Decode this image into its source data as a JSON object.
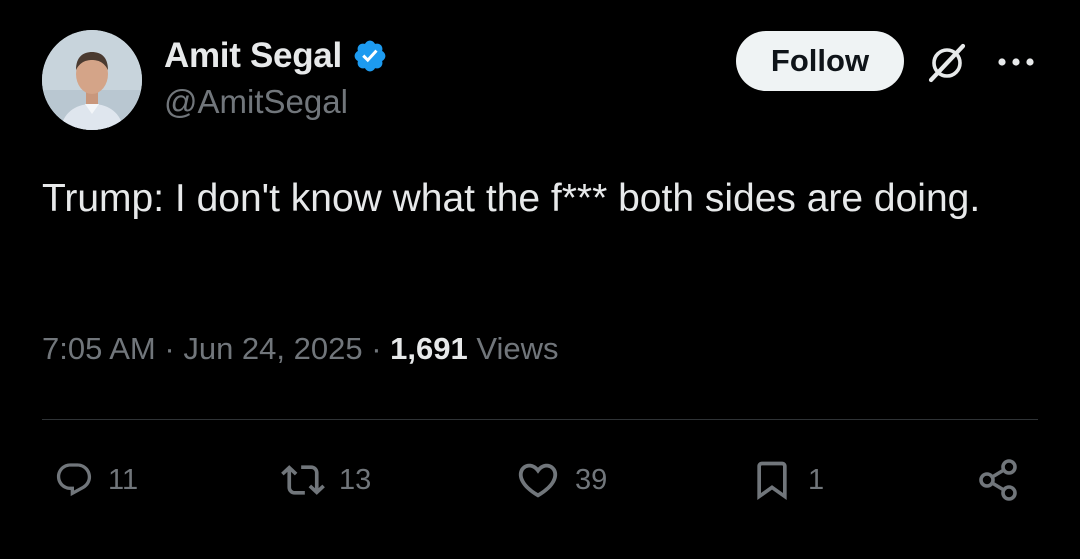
{
  "author": {
    "display_name": "Amit Segal",
    "handle": "@AmitSegal",
    "verified": true
  },
  "header": {
    "follow_label": "Follow"
  },
  "tweet": {
    "text": "Trump: I don't know what the f*** both sides are doing.",
    "time": "7:05 AM",
    "separator": "·",
    "date": "Jun 24, 2025",
    "views_count": "1,691",
    "views_label": "Views"
  },
  "actions": {
    "replies": "11",
    "reposts": "13",
    "likes": "39",
    "bookmarks": "1"
  },
  "icons": {
    "verified": "verified-badge-icon",
    "grok": "grok-icon",
    "more": "more-horizontal-icon",
    "reply": "reply-icon",
    "repost": "repost-icon",
    "like": "heart-icon",
    "bookmark": "bookmark-icon",
    "share": "share-icon"
  },
  "colors": {
    "background": "#000000",
    "text_primary": "#e7e9ea",
    "text_secondary": "#71767b",
    "verified_blue": "#1d9bf0",
    "follow_bg": "#eff3f4",
    "divider": "#2f3336"
  }
}
